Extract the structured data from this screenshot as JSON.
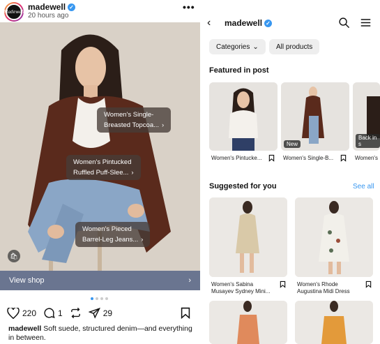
{
  "post": {
    "username": "madewell",
    "avatar_text": "Madewell",
    "time": "20 hours ago",
    "more": "•••",
    "tags": [
      {
        "line1": "Women's Single-",
        "line2": "Breasted Topcoa..."
      },
      {
        "line1": "Women's Pintucked",
        "line2": "Ruffled Puff-Slee..."
      },
      {
        "line1": "Women's Pieced",
        "line2": "Barrel-Leg Jeans..."
      }
    ],
    "view_shop": "View shop",
    "likes": "220",
    "comments": "1",
    "shares": "29",
    "caption_user": "madewell",
    "caption_text": "Soft suede, structured denim—and everything in between."
  },
  "shop": {
    "title": "madewell",
    "categories": "Categories",
    "all_products": "All products",
    "featured_heading": "Featured in post",
    "featured": [
      {
        "name": "Women's Pintucke...",
        "badge": ""
      },
      {
        "name": "Women's Single-B...",
        "badge": "New"
      },
      {
        "name": "Women's",
        "badge": "Back in s"
      }
    ],
    "suggested_heading": "Suggested for you",
    "see_all": "See all",
    "suggested": [
      {
        "line1": "Women's Sabina",
        "line2": "Musayev Sydney Mini..."
      },
      {
        "line1": "Women's Rhode",
        "line2": "Augustina Midi Dress"
      }
    ]
  },
  "colors": {
    "accent": "#3897f0",
    "view_shop_bg": "#6a7590"
  }
}
